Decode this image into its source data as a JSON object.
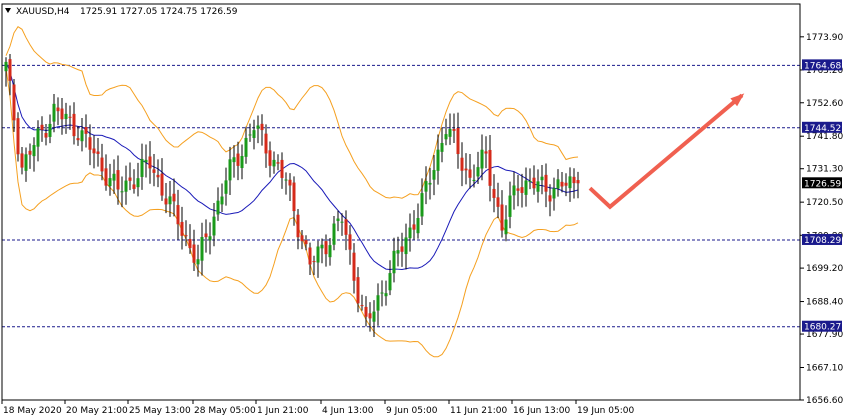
{
  "window": {
    "symbol": "XAUUSD,H4",
    "quote": "1725.91 1727.05 1724.75 1726.59"
  },
  "colors": {
    "background": "#ffffff",
    "bull": "#1a9a1a",
    "bear": "#d42a1a",
    "wick": "#000000",
    "bollinger": "#f5a020",
    "ma": "#1a1ab8",
    "level_line": "#1a1a8c",
    "level_label_bg": "#1a1a8c",
    "current_label_bg": "#000000",
    "arrow": "#f06050"
  },
  "chart_data": {
    "type": "candlestick",
    "instrument": "XAUUSD",
    "timeframe": "H4",
    "ylim": [
      1656.6,
      1784.5
    ],
    "y_ticks": [
      "1773.90",
      "1763.20",
      "1752.60",
      "1741.80",
      "1731.30",
      "1720.50",
      "1709.80",
      "1699.20",
      "1688.40",
      "1677.90",
      "1667.10",
      "1656.60"
    ],
    "x_ticks": [
      "18 May 2020",
      "20 May 21:00",
      "25 May 13:00",
      "28 May 05:00",
      "1 Jun 21:00",
      "4 Jun 13:00",
      "9 Jun 05:00",
      "11 Jun 21:00",
      "16 Jun 13:00",
      "19 Jun 05:00"
    ],
    "levels": [
      {
        "value": 1764.68,
        "label": "1764.68"
      },
      {
        "value": 1744.52,
        "label": "1744.52"
      },
      {
        "value": 1708.29,
        "label": "1708.29"
      },
      {
        "value": 1680.27,
        "label": "1680.27"
      }
    ],
    "current_price": {
      "value": 1726.59,
      "label": "1726.59"
    },
    "candle_count": 144,
    "key_closes": [
      {
        "index": 0,
        "close": 1764
      },
      {
        "index": 4,
        "close": 1732
      },
      {
        "index": 12,
        "close": 1750
      },
      {
        "index": 18,
        "close": 1744
      },
      {
        "index": 28,
        "close": 1724
      },
      {
        "index": 36,
        "close": 1733
      },
      {
        "index": 48,
        "close": 1701
      },
      {
        "index": 55,
        "close": 1728
      },
      {
        "index": 62,
        "close": 1745
      },
      {
        "index": 70,
        "close": 1727
      },
      {
        "index": 76,
        "close": 1700
      },
      {
        "index": 84,
        "close": 1715
      },
      {
        "index": 90,
        "close": 1680
      },
      {
        "index": 96,
        "close": 1698
      },
      {
        "index": 104,
        "close": 1720
      },
      {
        "index": 110,
        "close": 1745
      },
      {
        "index": 116,
        "close": 1728
      },
      {
        "index": 120,
        "close": 1735
      },
      {
        "index": 124,
        "close": 1712
      },
      {
        "index": 128,
        "close": 1727
      },
      {
        "index": 136,
        "close": 1725
      },
      {
        "index": 143,
        "close": 1726.59
      }
    ],
    "forecast_arrow": {
      "from": {
        "index": 146,
        "price": 1725
      },
      "via": {
        "index": 151,
        "price": 1719
      },
      "to": {
        "index": 184,
        "price": 1755
      }
    },
    "grid": false,
    "legend": "none"
  }
}
